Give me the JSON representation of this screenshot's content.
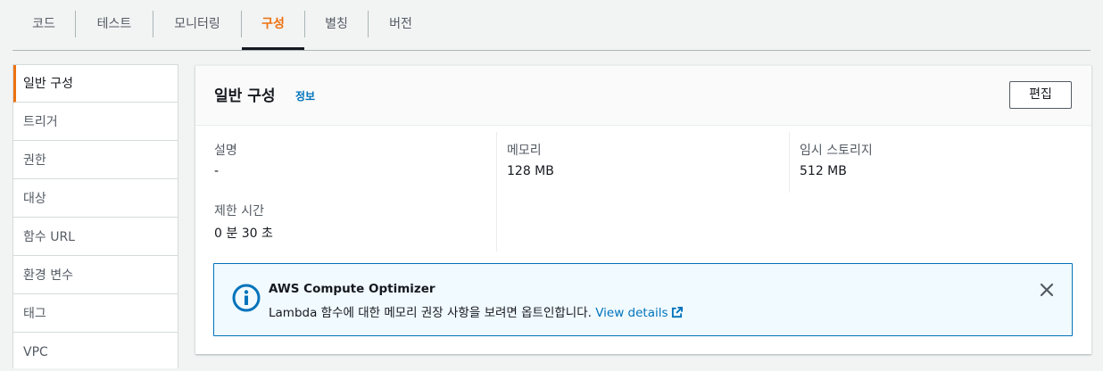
{
  "tabs": [
    {
      "label": "코드"
    },
    {
      "label": "테스트"
    },
    {
      "label": "모니터링"
    },
    {
      "label": "구성"
    },
    {
      "label": "별칭"
    },
    {
      "label": "버전"
    }
  ],
  "active_tab": "구성",
  "sidebar": {
    "items": [
      {
        "label": "일반 구성"
      },
      {
        "label": "트리거"
      },
      {
        "label": "권한"
      },
      {
        "label": "대상"
      },
      {
        "label": "함수 URL"
      },
      {
        "label": "환경 변수"
      },
      {
        "label": "태그"
      },
      {
        "label": "VPC"
      }
    ],
    "active": "일반 구성"
  },
  "panel": {
    "title": "일반 구성",
    "info_link": "정보",
    "edit_label": "편집",
    "fields": {
      "description": {
        "label": "설명",
        "value": "-"
      },
      "memory": {
        "label": "메모리",
        "value": "128 MB"
      },
      "ephemeral_storage": {
        "label": "임시 스토리지",
        "value": "512 MB"
      },
      "timeout": {
        "label": "제한 시간",
        "value": "0 분 30 초"
      }
    }
  },
  "alert": {
    "title": "AWS Compute Optimizer",
    "body": "Lambda 함수에 대한 메모리 권장 사항을 보려면 옵트인합니다.",
    "link": "View details",
    "icon": "info-icon"
  },
  "colors": {
    "accent": "#ec7211",
    "link": "#0073bb",
    "alert_bg": "#f1faff"
  }
}
